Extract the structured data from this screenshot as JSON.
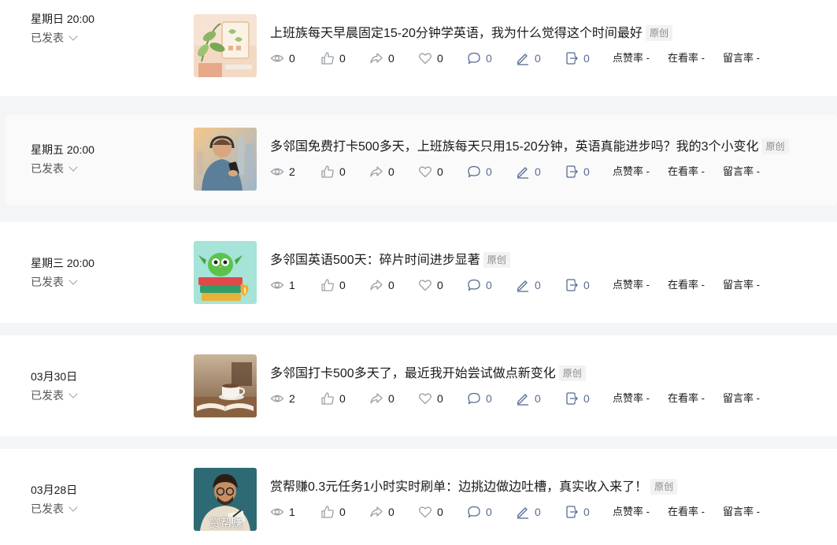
{
  "status_label": "已发表",
  "badge_label": "原创",
  "rate_labels": {
    "like_rate": "点赞率",
    "watch_rate": "在看率",
    "comment_rate": "留言率",
    "empty": "-"
  },
  "colors": {
    "accent_blue": "#576b95",
    "background": "#f4f5f7",
    "card": "#ffffff"
  },
  "icons": [
    "eye-icon",
    "thumbs-up-icon",
    "share-icon",
    "heart-icon",
    "comment-icon",
    "pen-icon",
    "external-icon",
    "chevron-down-icon"
  ],
  "articles": [
    {
      "date": "星期日 20:00",
      "title": "上班族每天早晨固定15-20分钟学英语，我为什么觉得这个时间最好",
      "thumb": "plant-tablet",
      "views": "0",
      "likes": "0",
      "shares": "0",
      "hearts": "0",
      "comments": "0",
      "notes": "0",
      "forwards": "0"
    },
    {
      "date": "星期五 20:00",
      "title": "多邻国免费打卡500多天，上班族每天只用15-20分钟，英语真能进步吗？我的3个小变化",
      "thumb": "man-phone",
      "views": "2",
      "likes": "0",
      "shares": "0",
      "hearts": "0",
      "comments": "0",
      "notes": "0",
      "forwards": "0"
    },
    {
      "date": "星期三 20:00",
      "title": "多邻国英语500天：碎片时间进步显著",
      "thumb": "owl-books",
      "views": "1",
      "likes": "0",
      "shares": "0",
      "hearts": "0",
      "comments": "0",
      "notes": "0",
      "forwards": "0"
    },
    {
      "date": "03月30日",
      "title": "多邻国打卡500多天了，最近我开始尝试做点新变化",
      "thumb": "coffee-book",
      "views": "2",
      "likes": "0",
      "shares": "0",
      "hearts": "0",
      "comments": "0",
      "notes": "0",
      "forwards": "0"
    },
    {
      "date": "03月28日",
      "title": "赏帮赚0.3元任务1小时实时刷单：边挑边做边吐槽，真实收入来了！",
      "thumb": "man-writing",
      "thumb_caption": "赏帮赚",
      "views": "1",
      "likes": "0",
      "shares": "0",
      "hearts": "0",
      "comments": "0",
      "notes": "0",
      "forwards": "0"
    }
  ]
}
